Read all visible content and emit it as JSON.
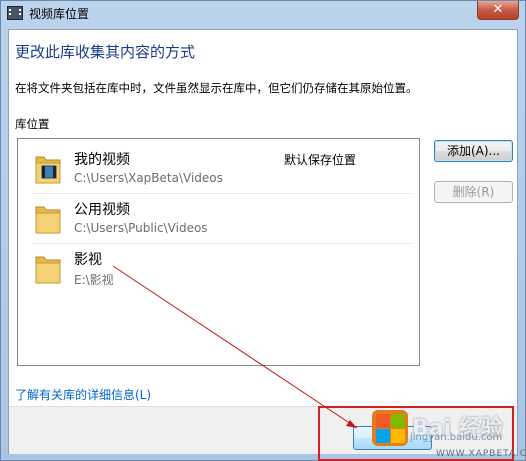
{
  "window": {
    "title": "视频库位置",
    "close_glyph": "✕"
  },
  "dialog": {
    "heading": "更改此库收集其内容的方式",
    "description": "在将文件夹包括在库中时，文件虽然显示在库中，但它们仍存储在其原始位置。",
    "locations_label": "库位置",
    "locations": [
      {
        "name": "我的视频",
        "path": "C:\\Users\\XapBeta\\Videos",
        "tag": "默认保存位置",
        "icon": "video-folder-icon"
      },
      {
        "name": "公用视频",
        "path": "C:\\Users\\Public\\Videos",
        "tag": "",
        "icon": "folder-icon"
      },
      {
        "name": "影视",
        "path": "E:\\影视",
        "tag": "",
        "icon": "folder-icon"
      }
    ],
    "add_button": "添加(A)...",
    "remove_button": "删除(R)",
    "learn_more_link": "了解有关库的详细信息(L)"
  },
  "watermark": {
    "text": "Bai 经验",
    "url": "jingyan.baidu.com",
    "site": "WWW.XAPBETA.COM"
  },
  "colors": {
    "heading": "#1a3d8f",
    "link": "#0066cc",
    "annotation": "#d32020"
  }
}
